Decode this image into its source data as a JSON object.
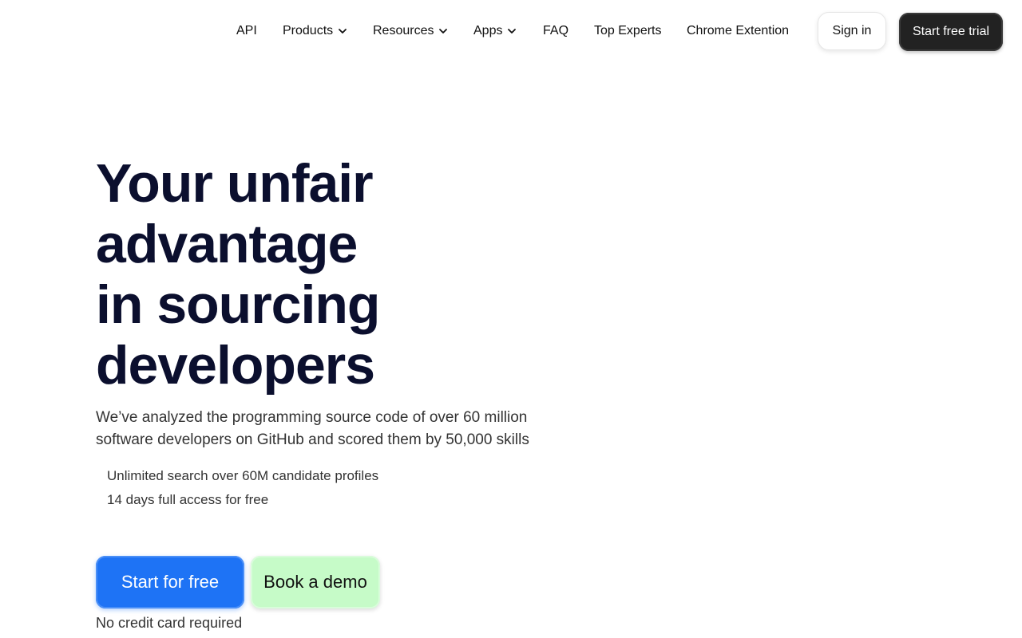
{
  "nav": {
    "items": [
      {
        "label": "API",
        "has_dropdown": false
      },
      {
        "label": "Products",
        "has_dropdown": true
      },
      {
        "label": "Resources",
        "has_dropdown": true
      },
      {
        "label": "Apps",
        "has_dropdown": true
      },
      {
        "label": "FAQ",
        "has_dropdown": false
      },
      {
        "label": "Top Experts",
        "has_dropdown": false
      },
      {
        "label": "Chrome Extention",
        "has_dropdown": false
      }
    ],
    "signin_label": "Sign in",
    "trial_label": "Start free trial"
  },
  "hero": {
    "title_lines": [
      "Your unfair",
      "advantage",
      "in sourcing",
      "developers"
    ],
    "subtitle": "We’ve analyzed the programming source code of over 60 million software developers on GitHub and scored them by 50,000 skills",
    "features": [
      "Unlimited search over 60M candidate profiles",
      "14 days full access for free"
    ],
    "cta_primary": "Start for free",
    "cta_secondary": "Book a demo",
    "note": "No credit card required"
  },
  "icons": {
    "dropdown": "chevron-down-icon"
  },
  "colors": {
    "title": "#0b0f2e",
    "primary_button": "#1e73f5",
    "secondary_button": "#c6fbc8",
    "dark_button": "#222222"
  }
}
